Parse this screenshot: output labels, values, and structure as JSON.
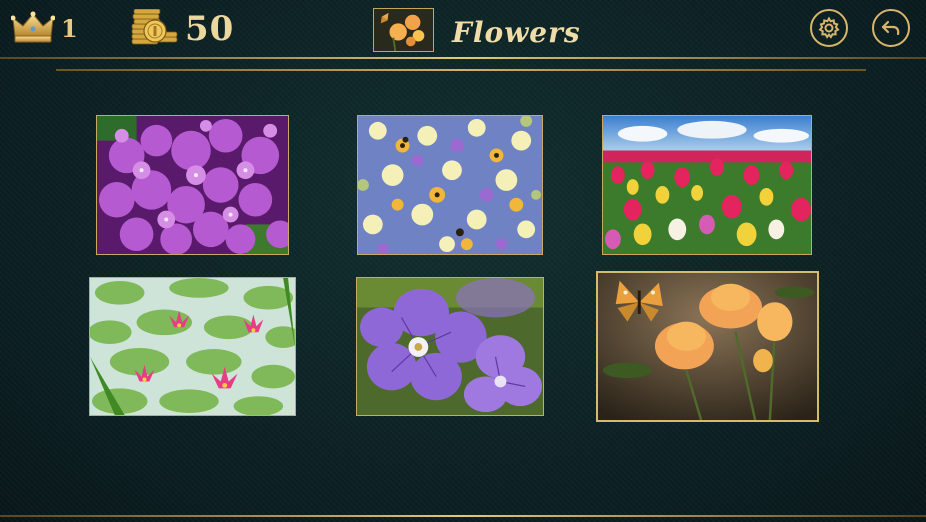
{
  "header": {
    "level": "1",
    "coins": "50",
    "category_title": "Flowers",
    "icons": {
      "level": "crown-icon",
      "coins": "coin-stack-icon",
      "settings": "gear-icon",
      "back": "back-arrow-icon"
    }
  },
  "colors": {
    "gold": "#d8b56a",
    "background": "#0d2326",
    "title_text": "#f0dca8"
  },
  "puzzles": [
    {
      "id": "lilac",
      "subject": "lilac"
    },
    {
      "id": "wildflowers",
      "subject": "wildflowers"
    },
    {
      "id": "tulip-field",
      "subject": "tulip-field"
    },
    {
      "id": "water-lilies",
      "subject": "water-lilies"
    },
    {
      "id": "geraniums",
      "subject": "geraniums"
    },
    {
      "id": "butterfly-flowers",
      "subject": "butterfly-flowers"
    }
  ]
}
